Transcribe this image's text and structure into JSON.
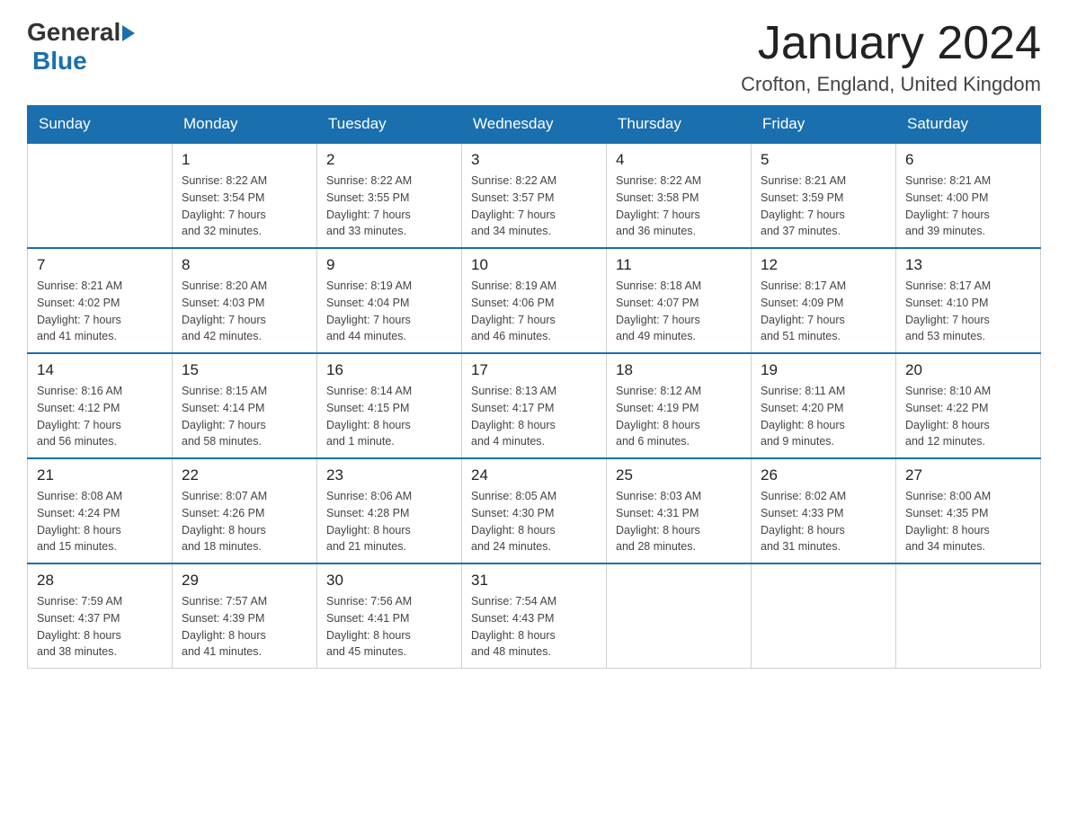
{
  "header": {
    "month_title": "January 2024",
    "location": "Crofton, England, United Kingdom",
    "logo_general": "General",
    "logo_blue": "Blue"
  },
  "days_of_week": [
    "Sunday",
    "Monday",
    "Tuesday",
    "Wednesday",
    "Thursday",
    "Friday",
    "Saturday"
  ],
  "weeks": [
    [
      {
        "num": "",
        "info": ""
      },
      {
        "num": "1",
        "info": "Sunrise: 8:22 AM\nSunset: 3:54 PM\nDaylight: 7 hours\nand 32 minutes."
      },
      {
        "num": "2",
        "info": "Sunrise: 8:22 AM\nSunset: 3:55 PM\nDaylight: 7 hours\nand 33 minutes."
      },
      {
        "num": "3",
        "info": "Sunrise: 8:22 AM\nSunset: 3:57 PM\nDaylight: 7 hours\nand 34 minutes."
      },
      {
        "num": "4",
        "info": "Sunrise: 8:22 AM\nSunset: 3:58 PM\nDaylight: 7 hours\nand 36 minutes."
      },
      {
        "num": "5",
        "info": "Sunrise: 8:21 AM\nSunset: 3:59 PM\nDaylight: 7 hours\nand 37 minutes."
      },
      {
        "num": "6",
        "info": "Sunrise: 8:21 AM\nSunset: 4:00 PM\nDaylight: 7 hours\nand 39 minutes."
      }
    ],
    [
      {
        "num": "7",
        "info": "Sunrise: 8:21 AM\nSunset: 4:02 PM\nDaylight: 7 hours\nand 41 minutes."
      },
      {
        "num": "8",
        "info": "Sunrise: 8:20 AM\nSunset: 4:03 PM\nDaylight: 7 hours\nand 42 minutes."
      },
      {
        "num": "9",
        "info": "Sunrise: 8:19 AM\nSunset: 4:04 PM\nDaylight: 7 hours\nand 44 minutes."
      },
      {
        "num": "10",
        "info": "Sunrise: 8:19 AM\nSunset: 4:06 PM\nDaylight: 7 hours\nand 46 minutes."
      },
      {
        "num": "11",
        "info": "Sunrise: 8:18 AM\nSunset: 4:07 PM\nDaylight: 7 hours\nand 49 minutes."
      },
      {
        "num": "12",
        "info": "Sunrise: 8:17 AM\nSunset: 4:09 PM\nDaylight: 7 hours\nand 51 minutes."
      },
      {
        "num": "13",
        "info": "Sunrise: 8:17 AM\nSunset: 4:10 PM\nDaylight: 7 hours\nand 53 minutes."
      }
    ],
    [
      {
        "num": "14",
        "info": "Sunrise: 8:16 AM\nSunset: 4:12 PM\nDaylight: 7 hours\nand 56 minutes."
      },
      {
        "num": "15",
        "info": "Sunrise: 8:15 AM\nSunset: 4:14 PM\nDaylight: 7 hours\nand 58 minutes."
      },
      {
        "num": "16",
        "info": "Sunrise: 8:14 AM\nSunset: 4:15 PM\nDaylight: 8 hours\nand 1 minute."
      },
      {
        "num": "17",
        "info": "Sunrise: 8:13 AM\nSunset: 4:17 PM\nDaylight: 8 hours\nand 4 minutes."
      },
      {
        "num": "18",
        "info": "Sunrise: 8:12 AM\nSunset: 4:19 PM\nDaylight: 8 hours\nand 6 minutes."
      },
      {
        "num": "19",
        "info": "Sunrise: 8:11 AM\nSunset: 4:20 PM\nDaylight: 8 hours\nand 9 minutes."
      },
      {
        "num": "20",
        "info": "Sunrise: 8:10 AM\nSunset: 4:22 PM\nDaylight: 8 hours\nand 12 minutes."
      }
    ],
    [
      {
        "num": "21",
        "info": "Sunrise: 8:08 AM\nSunset: 4:24 PM\nDaylight: 8 hours\nand 15 minutes."
      },
      {
        "num": "22",
        "info": "Sunrise: 8:07 AM\nSunset: 4:26 PM\nDaylight: 8 hours\nand 18 minutes."
      },
      {
        "num": "23",
        "info": "Sunrise: 8:06 AM\nSunset: 4:28 PM\nDaylight: 8 hours\nand 21 minutes."
      },
      {
        "num": "24",
        "info": "Sunrise: 8:05 AM\nSunset: 4:30 PM\nDaylight: 8 hours\nand 24 minutes."
      },
      {
        "num": "25",
        "info": "Sunrise: 8:03 AM\nSunset: 4:31 PM\nDaylight: 8 hours\nand 28 minutes."
      },
      {
        "num": "26",
        "info": "Sunrise: 8:02 AM\nSunset: 4:33 PM\nDaylight: 8 hours\nand 31 minutes."
      },
      {
        "num": "27",
        "info": "Sunrise: 8:00 AM\nSunset: 4:35 PM\nDaylight: 8 hours\nand 34 minutes."
      }
    ],
    [
      {
        "num": "28",
        "info": "Sunrise: 7:59 AM\nSunset: 4:37 PM\nDaylight: 8 hours\nand 38 minutes."
      },
      {
        "num": "29",
        "info": "Sunrise: 7:57 AM\nSunset: 4:39 PM\nDaylight: 8 hours\nand 41 minutes."
      },
      {
        "num": "30",
        "info": "Sunrise: 7:56 AM\nSunset: 4:41 PM\nDaylight: 8 hours\nand 45 minutes."
      },
      {
        "num": "31",
        "info": "Sunrise: 7:54 AM\nSunset: 4:43 PM\nDaylight: 8 hours\nand 48 minutes."
      },
      {
        "num": "",
        "info": ""
      },
      {
        "num": "",
        "info": ""
      },
      {
        "num": "",
        "info": ""
      }
    ]
  ]
}
